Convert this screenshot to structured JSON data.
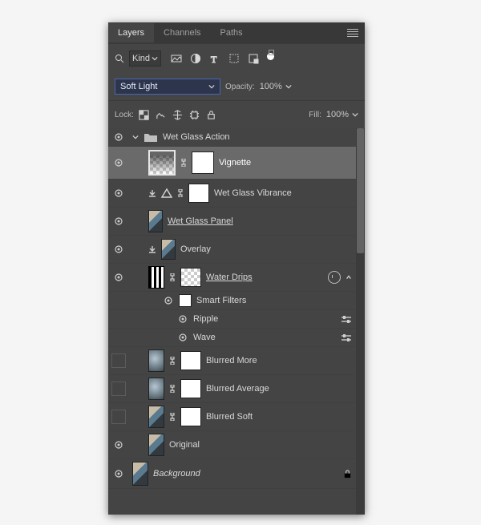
{
  "tabs": {
    "layers": "Layers",
    "channels": "Channels",
    "paths": "Paths"
  },
  "filter": {
    "kind": "Kind"
  },
  "blend": {
    "mode": "Soft Light",
    "opacity_label": "Opacity:",
    "opacity_value": "100%"
  },
  "lock": {
    "label": "Lock:",
    "fill_label": "Fill:",
    "fill_value": "100%"
  },
  "group": {
    "name": "Wet Glass Action"
  },
  "layers": {
    "vignette": "Vignette",
    "vibrance": "Wet Glass Vibrance",
    "panel": " Wet Glass Panel ",
    "overlay": "Overlay",
    "drips": " Water Drips ",
    "smart": "Smart Filters",
    "ripple": "Ripple",
    "wave": "Wave",
    "blur_more": "Blurred More",
    "blur_avg": "Blurred Average",
    "blur_soft": "Blurred Soft",
    "original": "Original",
    "background": "Background"
  }
}
